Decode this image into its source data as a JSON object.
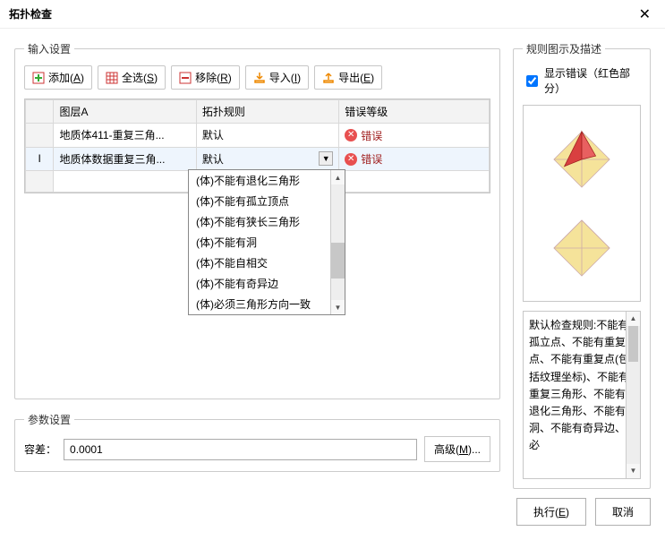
{
  "title": "拓扑检查",
  "groups": {
    "input": "输入设置",
    "params": "参数设置",
    "desc": "规则图示及描述"
  },
  "toolbar": {
    "add": {
      "label": "添加",
      "key": "A"
    },
    "selall": {
      "label": "全选",
      "key": "S"
    },
    "remove": {
      "label": "移除",
      "key": "R"
    },
    "import": {
      "label": "导入",
      "key": "I"
    },
    "export": {
      "label": "导出",
      "key": "E"
    }
  },
  "grid": {
    "headers": {
      "layerA": "图层A",
      "rule": "拓扑规则",
      "errlevel": "错误等级"
    },
    "rows": [
      {
        "marker": "",
        "layerA": "地质体411-重复三角...",
        "rule": "默认",
        "errlevel": "错误",
        "selected": false
      },
      {
        "marker": "I",
        "layerA": "地质体数据重复三角...",
        "rule": "默认",
        "errlevel": "错误",
        "selected": true
      }
    ],
    "dropdown_options": [
      "(体)不能有退化三角形",
      "(体)不能有孤立顶点",
      "(体)不能有狭长三角形",
      "(体)不能有洞",
      "(体)不能自相交",
      "(体)不能有奇异边",
      "(体)必须三角形方向一致"
    ]
  },
  "params": {
    "tolerance_label": "容差：",
    "tolerance_value": "0.0001",
    "advanced_label": "高级",
    "advanced_key": "M"
  },
  "desc": {
    "show_error_label": "显示错误（红色部分）",
    "show_error_checked": true,
    "text": "默认检查规则:不能有孤立点、不能有重复点、不能有重复点(包括纹理坐标)、不能有重复三角形、不能有退化三角形、不能有洞、不能有奇异边、必"
  },
  "footer": {
    "execute_label": "执行",
    "execute_key": "E",
    "cancel_label": "取消"
  }
}
